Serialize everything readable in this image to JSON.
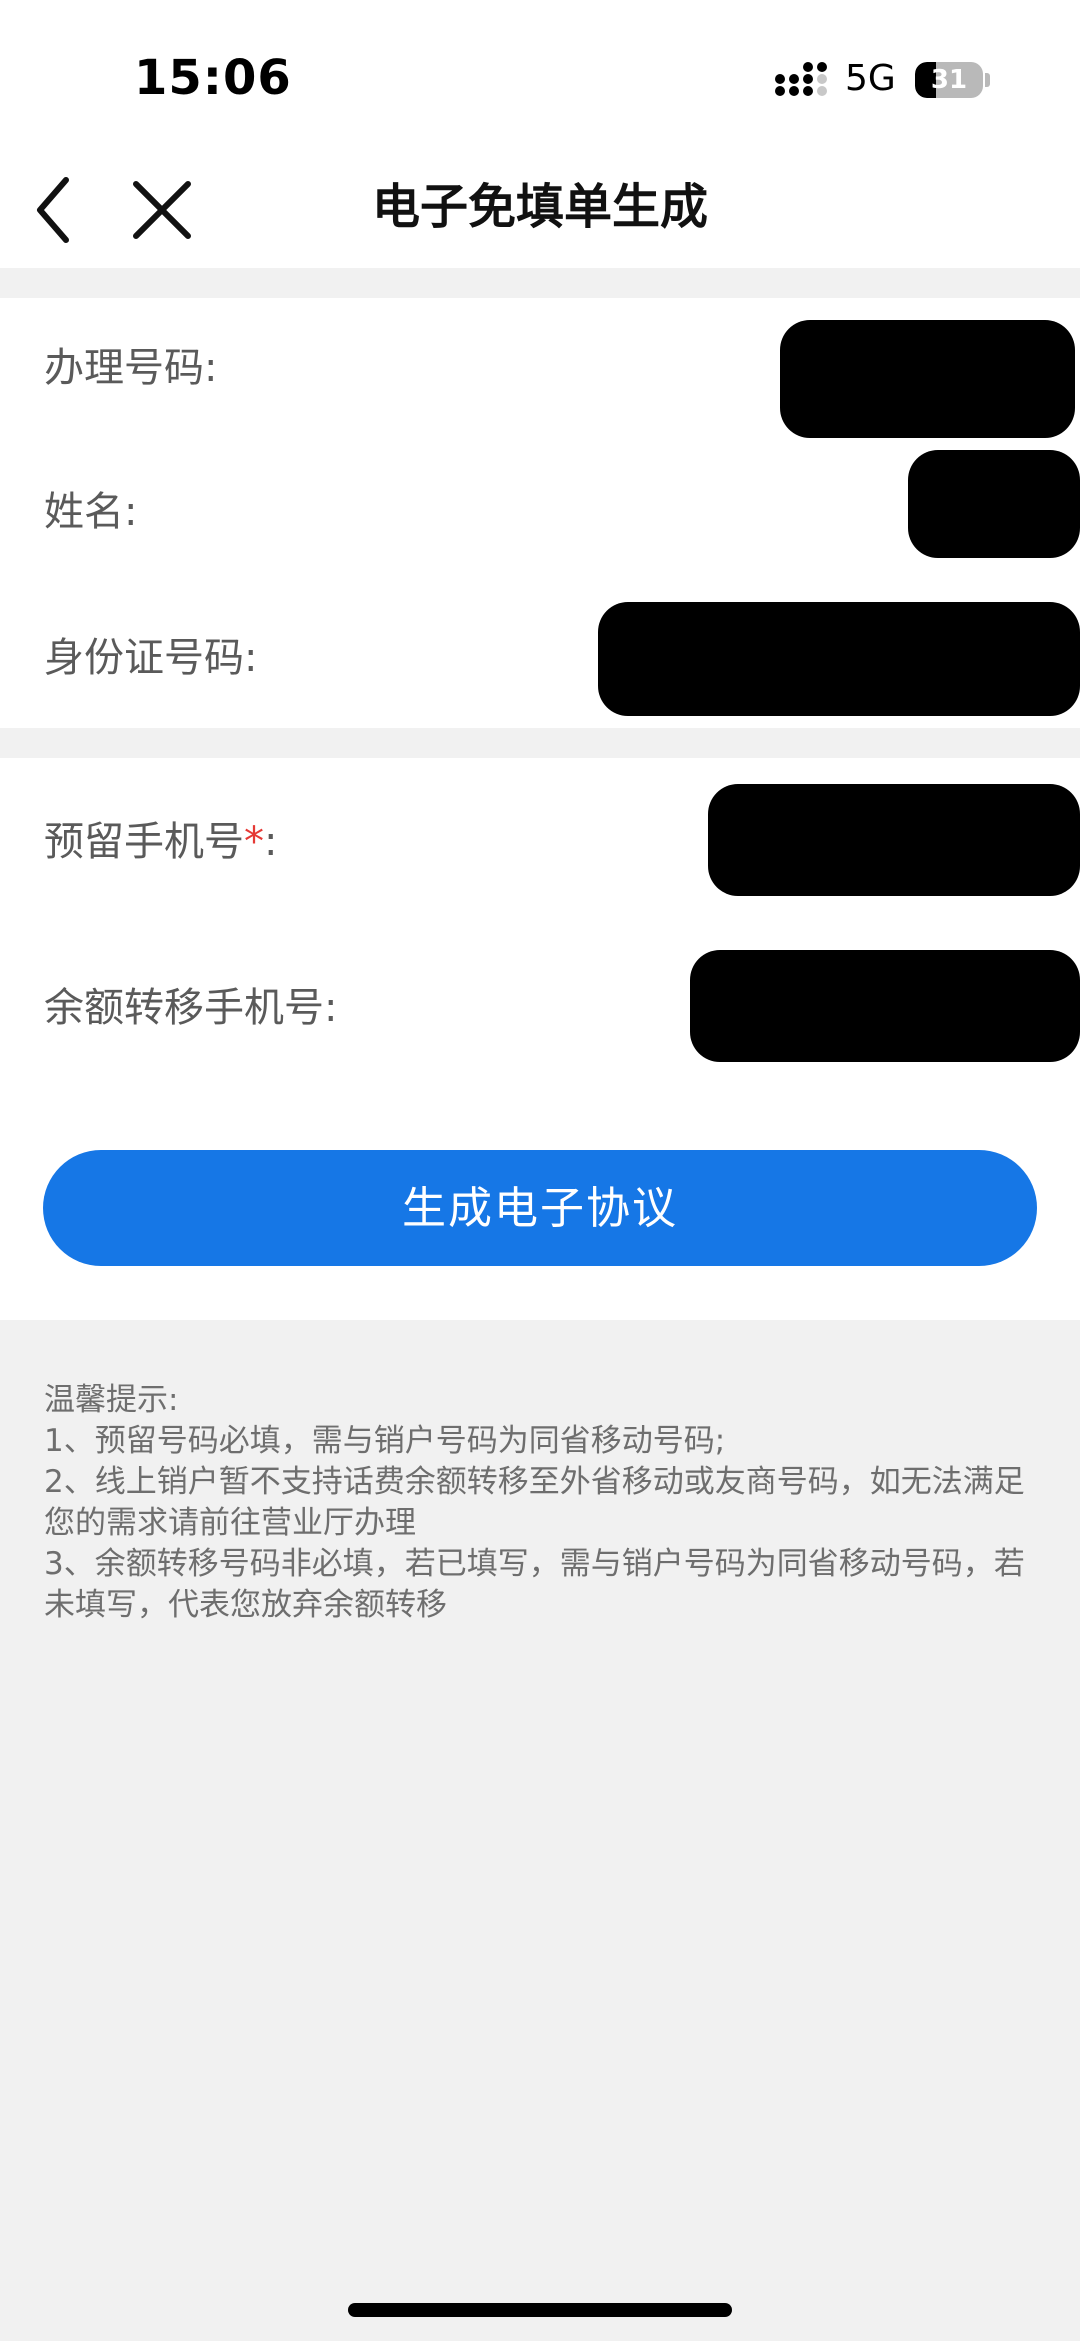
{
  "status_bar": {
    "time": "15:06",
    "network": "5G",
    "battery_level": "31",
    "battery_fraction": 0.31
  },
  "header": {
    "title": "电子免填单生成",
    "back_icon": "chevron-left-icon",
    "close_icon": "close-icon"
  },
  "form": {
    "section_1": {
      "phone_label": "办理号码:",
      "name_label": "姓名:",
      "id_label": "身份证号码:"
    },
    "section_2": {
      "reserved_phone_label": "预留手机号",
      "required_mark": "*",
      "label_suffix": ":",
      "transfer_phone_label": "余额转移手机号:"
    },
    "submit_label": "生成电子协议"
  },
  "tips": {
    "title": "温馨提示:",
    "items": [
      "1、预留号码必填，需与销户号码为同省移动号码;",
      "2、线上销户暂不支持话费余额转移至外省移动或友商号码，如无法满足您的需求请前往营业厅办理",
      "3、余额转移号码非必填，若已填写，需与销户号码为同省移动号码，若未填写，代表您放弃余额转移"
    ]
  },
  "colors": {
    "primary": "#1677e6",
    "required": "#e53935",
    "background": "#f1f1f1"
  }
}
